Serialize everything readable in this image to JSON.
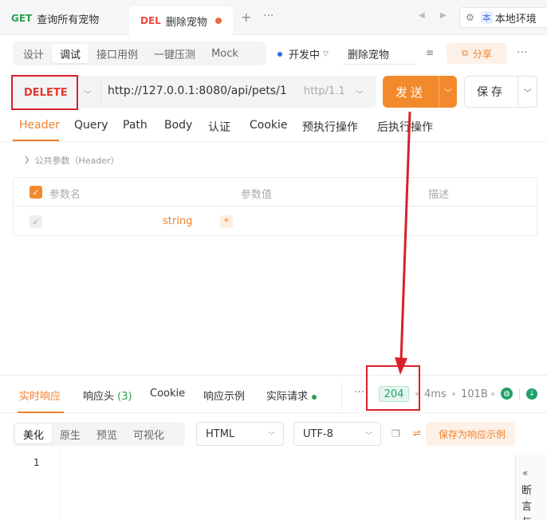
{
  "tabs": [
    {
      "method": "GET",
      "name": "查询所有宠物"
    },
    {
      "method": "DEL",
      "name": "删除宠物"
    }
  ],
  "tab_add": "+",
  "tab_more": "···",
  "environment": {
    "badge": "本",
    "name": "本地环境"
  },
  "modes": [
    "设计",
    "调试",
    "接口用例",
    "一键压测",
    "Mock"
  ],
  "status": "开发中",
  "api_name": "删除宠物",
  "share_label": "分享",
  "request": {
    "method": "DELETE",
    "url": "http://127.0.0.1:8080/api/pets/1",
    "http_version": "http/1.1",
    "send_label": "发送",
    "save_label": "保存"
  },
  "request_tabs": [
    "Header",
    "Query",
    "Path",
    "Body",
    "认证",
    "Cookie",
    "预执行操作",
    "后执行操作"
  ],
  "public_params": "公共参数（Header）",
  "params_table": {
    "headers": [
      "参数名",
      "参数值",
      "描述"
    ],
    "rows": [
      {
        "name": "",
        "type": "string",
        "required": "*",
        "value": "",
        "desc": ""
      }
    ]
  },
  "response_tabs": {
    "live": "实时响应",
    "headers": "响应头",
    "headers_count": "(3)",
    "cookie": "Cookie",
    "example": "响应示例",
    "actual": "实际请求"
  },
  "response_meta": {
    "status_code": "204",
    "time": "4ms",
    "size": "101B"
  },
  "view_modes": [
    "美化",
    "原生",
    "预览",
    "可视化"
  ],
  "format": "HTML",
  "encoding": "UTF-8",
  "save_example_label": "保存为响应示例",
  "line_number": "1",
  "side_panel_text": "断言与",
  "colors": {
    "accent": "#f28a2c",
    "delete": "#e5392f",
    "get": "#2ea04f",
    "success": "#21a06a",
    "annotation": "#d9202c"
  }
}
